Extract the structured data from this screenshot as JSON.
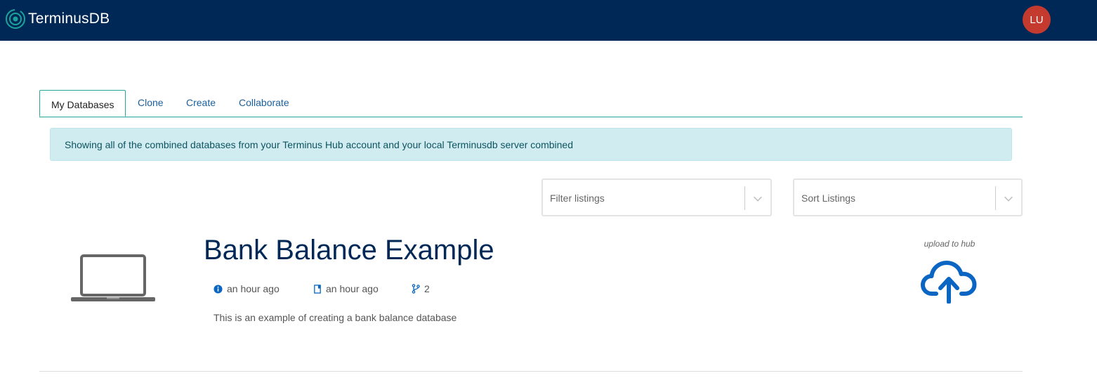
{
  "brand": {
    "name": "TerminusDB",
    "accent": "#1aa39a"
  },
  "user": {
    "initials": "LU"
  },
  "tabs": [
    {
      "label": "My Databases",
      "active": true
    },
    {
      "label": "Clone",
      "active": false
    },
    {
      "label": "Create",
      "active": false
    },
    {
      "label": "Collaborate",
      "active": false
    }
  ],
  "alert": {
    "text": "Showing all of the combined databases from your Terminus Hub account and your local Terminusdb server combined"
  },
  "filters": {
    "filter_placeholder": "Filter listings",
    "sort_placeholder": "Sort Listings"
  },
  "database": {
    "title": "Bank Balance Example",
    "created": "an hour ago",
    "updated": "an hour ago",
    "branches": "2",
    "description": "This is an example of creating a bank balance database",
    "upload_label": "upload to hub"
  },
  "colors": {
    "navbar": "#002856",
    "link": "#1a5f9e",
    "icon_blue": "#0a66c2",
    "avatar": "#c43a2f"
  }
}
